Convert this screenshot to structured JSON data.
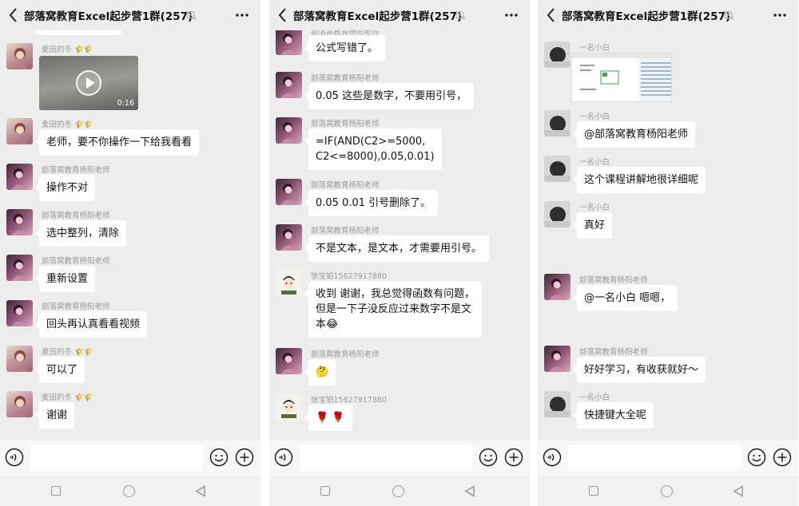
{
  "group_title": "部落窝教育Excel起步营1群(257)",
  "panels": [
    {
      "messages": [
        {
          "sender": "麦田的冬",
          "decor": "🌾🌾",
          "type": "video",
          "duration": "0:16"
        },
        {
          "sender": "麦田的冬",
          "decor": "🌾🌾",
          "type": "text",
          "text": "老师，要不你操作一下给我看看"
        },
        {
          "sender": "部落窝教育杨阳老师",
          "type": "text",
          "text": "操作不对"
        },
        {
          "sender": "部落窝教育杨阳老师",
          "type": "text",
          "text": "选中整列，清除"
        },
        {
          "sender": "部落窝教育杨阳老师",
          "type": "text",
          "text": "重新设置"
        },
        {
          "sender": "部落窝教育杨阳老师",
          "type": "text",
          "text": "回头再认真看看视频"
        },
        {
          "sender": "麦田的冬",
          "decor": "🌾🌾",
          "type": "text",
          "text": "可以了"
        },
        {
          "sender": "麦田的冬",
          "decor": "🌾🌾",
          "type": "text",
          "text": "谢谢"
        }
      ]
    },
    {
      "messages": [
        {
          "sender": "部落窝教育杨阳老师",
          "type": "text",
          "text": "公式写错了。"
        },
        {
          "sender": "部落窝教育杨阳老师",
          "type": "text",
          "text": "0.05  这些是数字，不要用引号，"
        },
        {
          "sender": "部落窝教育杨阳老师",
          "type": "text",
          "line1": "=IF(AND(C2>=5000,",
          "line2": "C2<=8000),0.05,0.01)"
        },
        {
          "sender": "部落窝教育杨阳老师",
          "type": "text",
          "text": "0.05  0.01  引号删除了。"
        },
        {
          "sender": "部落窝教育杨阳老师",
          "type": "text",
          "text": "不是文本，是文本，才需要用引号。"
        },
        {
          "sender": "徐宝铂15627917880",
          "type": "text",
          "line1": "收到 谢谢，我总觉得函数有问题，",
          "line2": "但是一下子没反应过来数字不是文",
          "line3": "本😂"
        },
        {
          "sender": "部落窝教育杨阳老师",
          "type": "text",
          "text": "🤔"
        },
        {
          "sender": "徐宝铂15627917880",
          "type": "text",
          "text": "🌹 🌹"
        }
      ]
    },
    {
      "messages": [
        {
          "sender": "一名小白",
          "type": "image"
        },
        {
          "sender": "一名小白",
          "type": "text",
          "text": "@部落窝教育杨阳老师"
        },
        {
          "sender": "一名小白",
          "type": "text",
          "text": "这个课程讲解地很详细呢"
        },
        {
          "sender": "一名小白",
          "type": "text",
          "text": "真好"
        },
        {
          "sender": "部落窝教育杨阳老师",
          "type": "text",
          "text": "@一名小白  嗯嗯，"
        },
        {
          "sender": "部落窝教育杨阳老师",
          "type": "text",
          "text": "好好学习，有收获就好～"
        },
        {
          "sender": "一名小白",
          "type": "text",
          "text": "快捷键大全呢"
        }
      ]
    }
  ]
}
